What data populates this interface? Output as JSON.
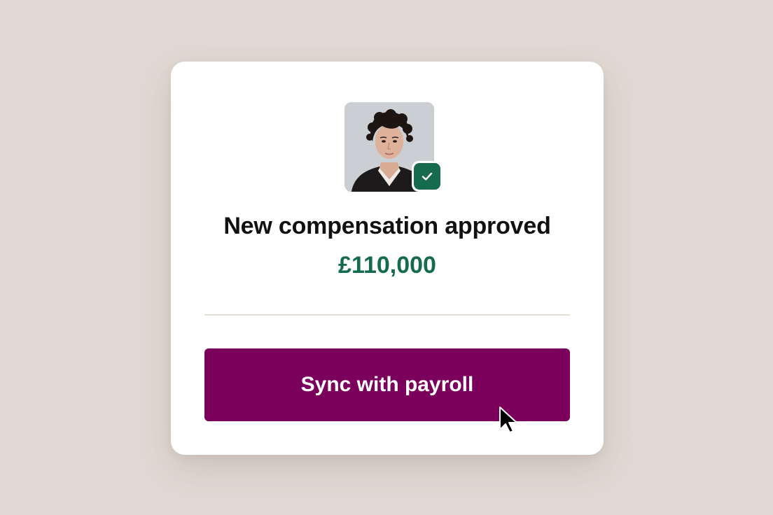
{
  "notification": {
    "title": "New compensation approved",
    "amount": "£110,000",
    "approved_badge_icon": "checkmark-icon",
    "avatar": "employee-photo"
  },
  "actions": {
    "sync_label": "Sync with payroll"
  },
  "colors": {
    "background": "#e1d9d3",
    "card": "#ffffff",
    "accent_green": "#166a4e",
    "button": "#7a005c",
    "divider": "#e6dfd6"
  }
}
